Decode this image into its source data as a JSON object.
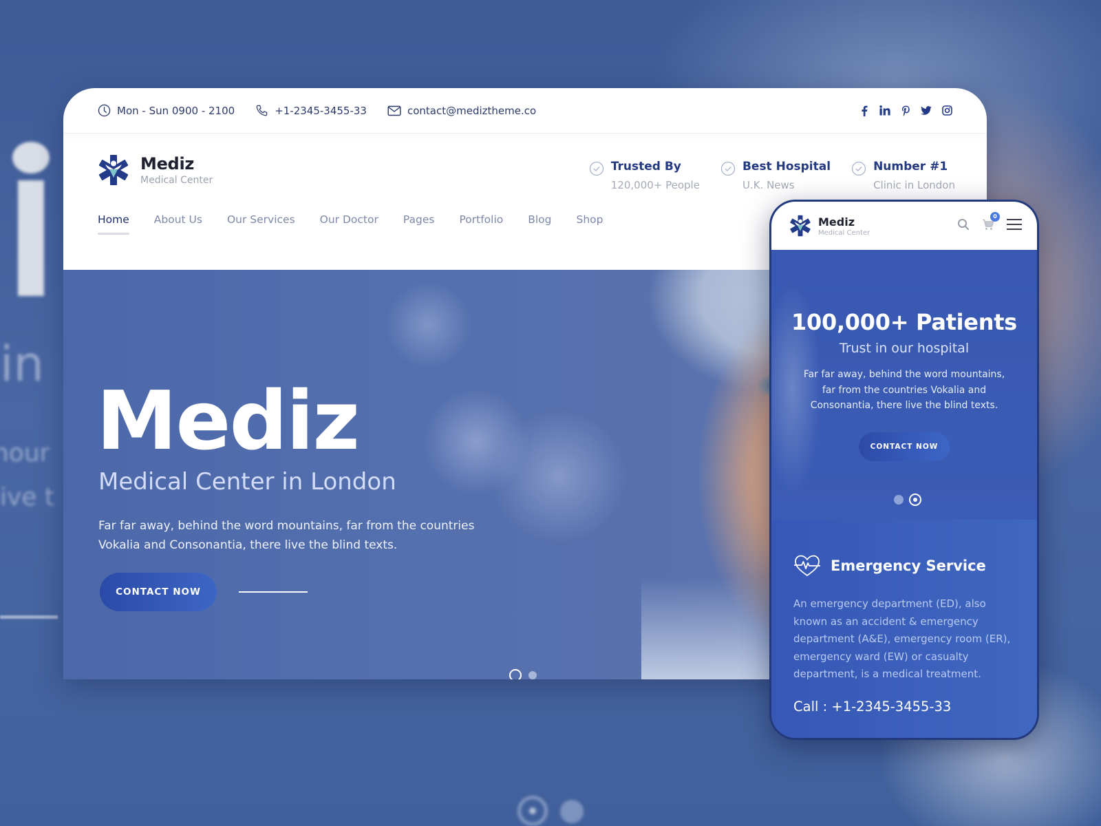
{
  "background": {
    "bg_words": [
      "in",
      "nour",
      "live t"
    ]
  },
  "topbar": {
    "hours": "Mon - Sun 0900 - 2100",
    "phone": "+1-2345-3455-33",
    "email": "contact@mediztheme.co",
    "icons": {
      "hours": "clock-icon",
      "phone": "phone-icon",
      "email": "mail-icon"
    },
    "socials": [
      {
        "name": "facebook",
        "glyph": "f"
      },
      {
        "name": "linkedin",
        "glyph": "in"
      },
      {
        "name": "pinterest",
        "glyph": "P"
      },
      {
        "name": "twitter",
        "glyph": "t"
      },
      {
        "name": "instagram",
        "glyph": "ig"
      }
    ]
  },
  "brand": {
    "name": "Mediz",
    "tagline": "Medical Center",
    "colors": {
      "primary": "#233a88",
      "accent": "#7fc4c9",
      "text": "#1e2130"
    }
  },
  "badges": [
    {
      "title": "Trusted By",
      "subtitle": "120,000+ People"
    },
    {
      "title": "Best Hospital",
      "subtitle": "U.K. News"
    },
    {
      "title": "Number #1",
      "subtitle": "Clinic in London"
    }
  ],
  "nav": {
    "items": [
      {
        "label": "Home",
        "active": true
      },
      {
        "label": "About Us",
        "active": false
      },
      {
        "label": "Our Services",
        "active": false
      },
      {
        "label": "Our Doctor",
        "active": false
      },
      {
        "label": "Pages",
        "active": false
      },
      {
        "label": "Portfolio",
        "active": false
      },
      {
        "label": "Blog",
        "active": false
      },
      {
        "label": "Shop",
        "active": false
      }
    ]
  },
  "hero": {
    "title": "Mediz",
    "subtitle": "Medical Center in London",
    "text": "Far far away, behind the word mountains, far from the countries Vokalia and Consonantia, there live the blind texts.",
    "cta": "CONTACT NOW",
    "slides": 2,
    "active_slide": 1
  },
  "mobile": {
    "brand_name": "Mediz",
    "brand_tagline": "Medical Center",
    "cart_count": "0",
    "hero": {
      "title": "100,000+ Patients",
      "subtitle": "Trust in our hospital",
      "text": "Far far away, behind the word mountains, far from the countries Vokalia and Consonantia, there live the blind texts.",
      "cta": "CONTACT NOW",
      "slides": 2,
      "active_slide": 2
    },
    "service": {
      "title": "Emergency Service",
      "text": "An emergency department (ED), also known as an accident & emergency department (A&E), emergency room (ER), emergency ward (EW) or casualty department, is a medical treatment.",
      "call": "Call : +1-2345-3455-33"
    }
  }
}
